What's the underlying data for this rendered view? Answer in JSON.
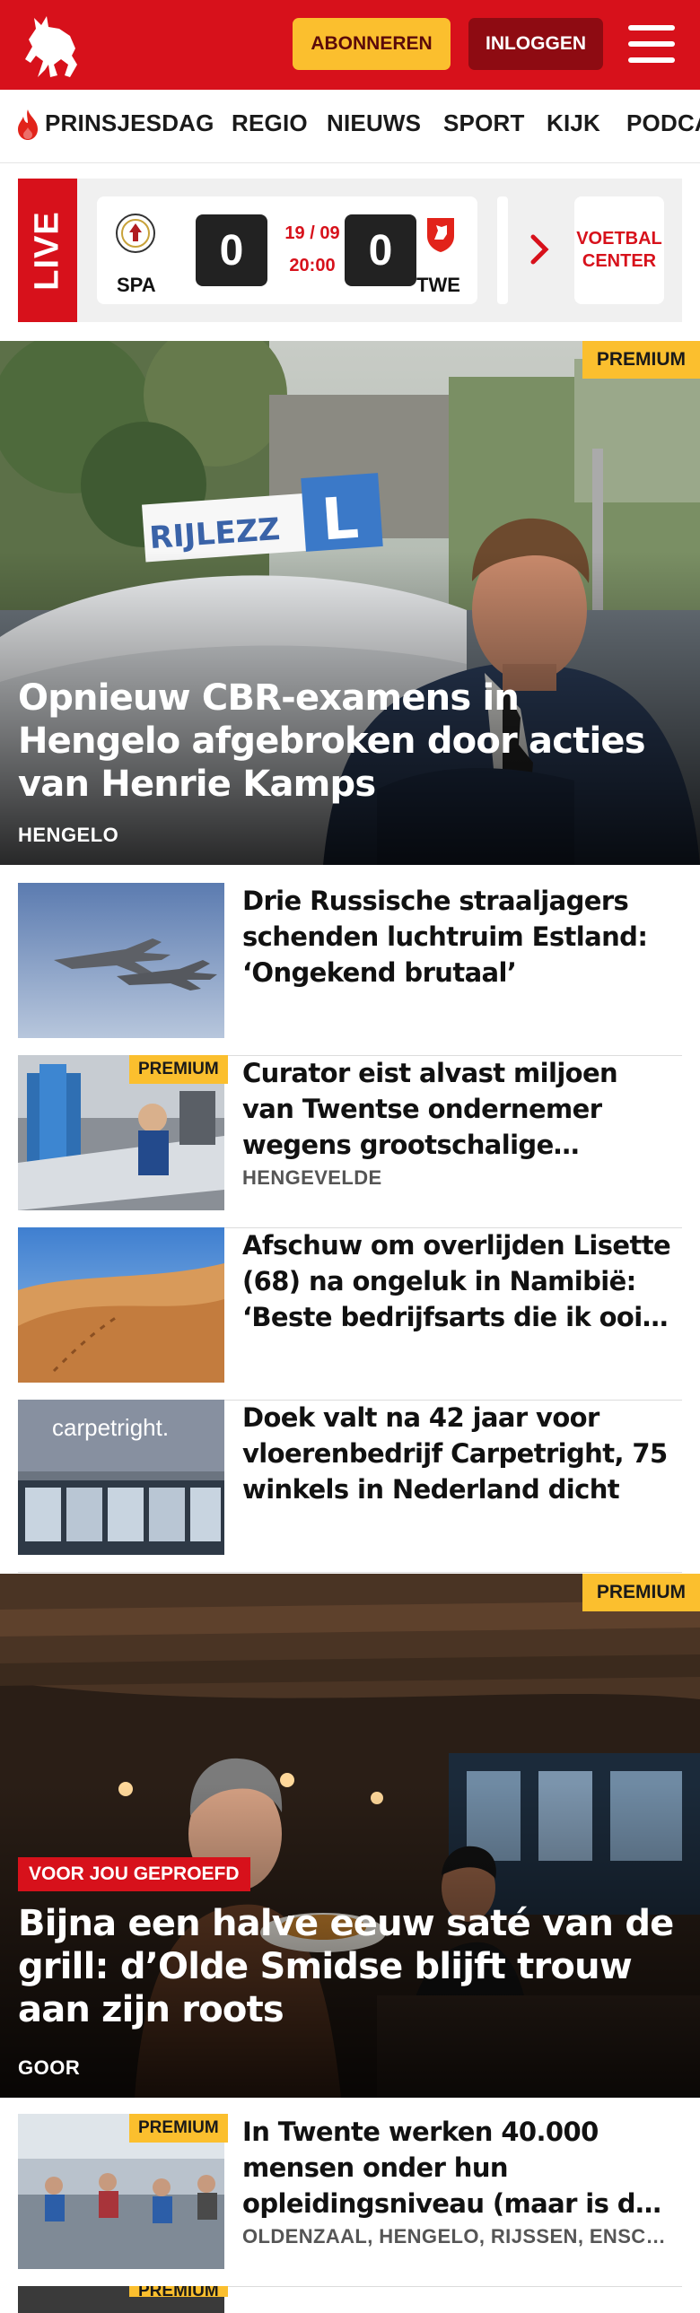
{
  "header": {
    "subscribe_label": "ABONNEREN",
    "login_label": "INLOGGEN"
  },
  "nav": {
    "items": [
      "PRINSJESDAG",
      "REGIO",
      "NIEUWS",
      "SPORT",
      "KIJK",
      "PODCA"
    ]
  },
  "live": {
    "label": "LIVE",
    "home_team": "SPA",
    "home_score": "0",
    "date": "19 / 09",
    "time": "20:00",
    "away_score": "0",
    "away_team": "TWE",
    "voetbal_center_line1": "VOETBAL",
    "voetbal_center_line2": "CENTER"
  },
  "hero1": {
    "badge": "PREMIUM",
    "title": "Opnieuw CBR-examens in Hengelo afgebroken door acties van Henrie Kamps",
    "location": "HENGELO",
    "sign_text": "RIJLEZZ",
    "sign_letter": "L"
  },
  "articles": [
    {
      "title": "Drie Russische straaljagers schenden luchtruim Estland: ‘Ongekend brutaal’",
      "location": "",
      "premium": ""
    },
    {
      "title": "Curator eist alvast miljoen van Twentse ondernemer wegens grootschalige leasefraude",
      "location": "HENGEVELDE",
      "premium": "PREMIUM"
    },
    {
      "title": "Afschuw om overlijden Lisette (68) na ongeluk in Namibië: ‘Beste bedrijfsarts die ik ooit heb gehad’",
      "location": "",
      "premium": ""
    },
    {
      "title": "Doek valt na 42 jaar voor vloerenbedrijf Carpetright, 75 winkels in Nederland dicht",
      "location": "",
      "premium": ""
    }
  ],
  "thumb_text": {
    "carpetright": "carpetright."
  },
  "hero2": {
    "badge": "PREMIUM",
    "tag": "VOOR JOU GEPROEFD",
    "title": "Bijna een halve eeuw saté van de grill: d’Olde Smidse blijft trouw aan zijn roots",
    "location": "GOOR"
  },
  "articles2": [
    {
      "title": "In Twente werken 40.000 mensen onder hun opleidingsni­veau (maar is dat erg?)",
      "location": "OLDENZAAL, HENGELO, RIJSSEN, ENSCHEDE",
      "premium": "PREMIUM"
    },
    {
      "title": "",
      "location": "",
      "premium": "PREMIUM"
    }
  ],
  "colors": {
    "brand_red": "#d7111b",
    "premium_yellow": "#fbbf2e",
    "dark_red": "#8e0b12"
  }
}
